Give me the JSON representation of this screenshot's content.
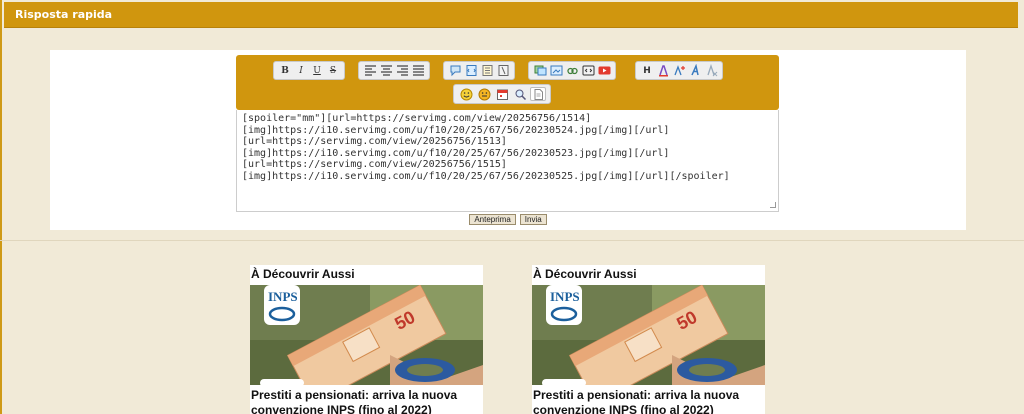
{
  "header": {
    "title": "Risposta rapida"
  },
  "toolbar": {
    "row1": [
      [
        "bold-icon",
        "italic-icon",
        "underline-icon",
        "strikethrough-icon"
      ],
      [
        "align-left-icon",
        "align-center-icon",
        "align-right-icon",
        "align-justify-icon"
      ],
      [
        "quote-icon",
        "code-icon",
        "list-icon",
        "hide-icon"
      ],
      [
        "image-icon",
        "host-image-icon",
        "link-icon",
        "embed-icon",
        "youtube-icon"
      ],
      [
        "heading-icon",
        "font-color-icon",
        "font-size-icon",
        "font-face-icon",
        "clear-format-icon"
      ]
    ],
    "row2": [
      "smiley-icon",
      "more-smilies-icon",
      "calendar-icon",
      "search-replace-icon",
      "source-toggle-icon"
    ]
  },
  "editor": {
    "content": "[spoiler=\"mm\"][url=https://servimg.com/view/20256756/1514]\n[img]https://i10.servimg.com/u/f10/20/25/67/56/20230524.jpg[/img][/url]\n[url=https://servimg.com/view/20256756/1513]\n[img]https://i10.servimg.com/u/f10/20/25/67/56/20230523.jpg[/img][/url]\n[url=https://servimg.com/view/20256756/1515]\n[img]https://i10.servimg.com/u/f10/20/25/67/56/20230525.jpg[/img][/url][/spoiler]"
  },
  "buttons": {
    "preview": "Anteprima",
    "send": "Invia"
  },
  "cards": [
    {
      "section": "À Découvrir Aussi",
      "headline": "Prestiti a pensionati: arriva la nuova convenzione INPS (fino al 2022)",
      "logo_text": "INPS",
      "note_text": "50"
    },
    {
      "section": "À Découvrir Aussi",
      "headline": "Prestiti a pensionati: arriva la nuova convenzione INPS (fino al 2022)",
      "logo_text": "INPS",
      "note_text": "50"
    }
  ],
  "colors": {
    "accent": "#d0960e",
    "background": "#f1ead7"
  }
}
